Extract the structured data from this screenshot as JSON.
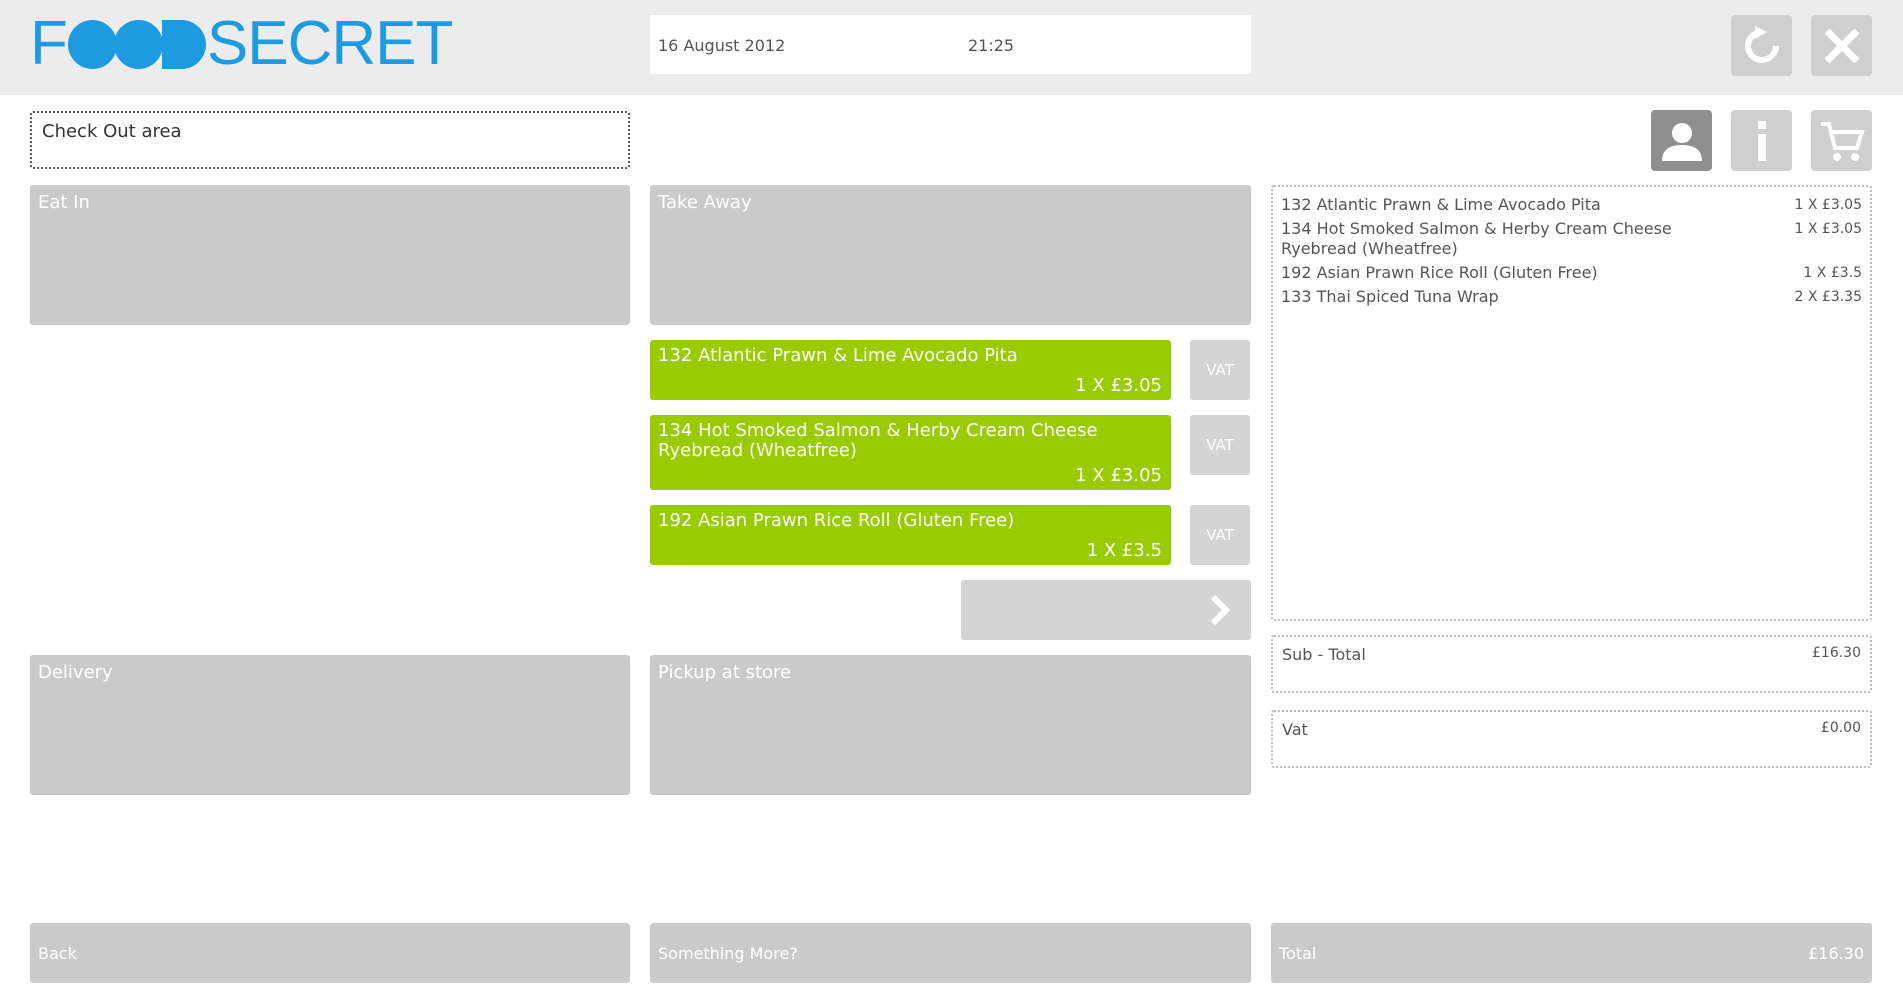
{
  "header": {
    "logo_text": "FOODSECRET",
    "logo_part1": "F",
    "logo_part2": "SECRET",
    "date": "16 August 2012",
    "time": "21:25"
  },
  "icons": {
    "refresh": "refresh-icon",
    "close": "close-icon",
    "user": "user-icon",
    "info": "info-icon",
    "cart": "cart-icon",
    "next": "chevron-right-icon"
  },
  "checkout_area": {
    "label": "Check Out area"
  },
  "tiles": {
    "eat_in": "Eat In",
    "take_away": "Take Away",
    "delivery": "Delivery",
    "pickup": "Pickup at store"
  },
  "order_items": [
    {
      "name": "132 Atlantic Prawn & Lime Avocado Pita",
      "qty": "1 X £3.05",
      "vat": "VAT"
    },
    {
      "name": "134 Hot Smoked Salmon & Herby Cream Cheese Ryebread (Wheatfree)",
      "qty": "1 X £3.05",
      "vat": "VAT"
    },
    {
      "name": "192 Asian Prawn Rice Roll (Gluten Free)",
      "qty": "1 X £3.5",
      "vat": "VAT"
    }
  ],
  "summary": {
    "items": [
      {
        "name": "132 Atlantic Prawn & Lime Avocado Pita",
        "qty": "1 X £3.05"
      },
      {
        "name": "134 Hot Smoked Salmon & Herby Cream Cheese Ryebread (Wheatfree)",
        "qty": "1 X £3.05"
      },
      {
        "name": "192 Asian Prawn Rice Roll (Gluten Free)",
        "qty": "1 X £3.5"
      },
      {
        "name": "133 Thai Spiced Tuna Wrap",
        "qty": "2 X £3.35"
      }
    ],
    "subtotal_label": "Sub - Total",
    "subtotal_value": "£16.30",
    "vat_label": "Vat",
    "vat_value": "£0.00"
  },
  "bottom": {
    "back": "Back",
    "more": "Something More?",
    "total_label": "Total",
    "total_value": "£16.30"
  },
  "colors": {
    "brand": "#1e9be0",
    "item_green": "#99cc00",
    "tile_grey": "#cacaca",
    "header_bg": "#ececec"
  }
}
